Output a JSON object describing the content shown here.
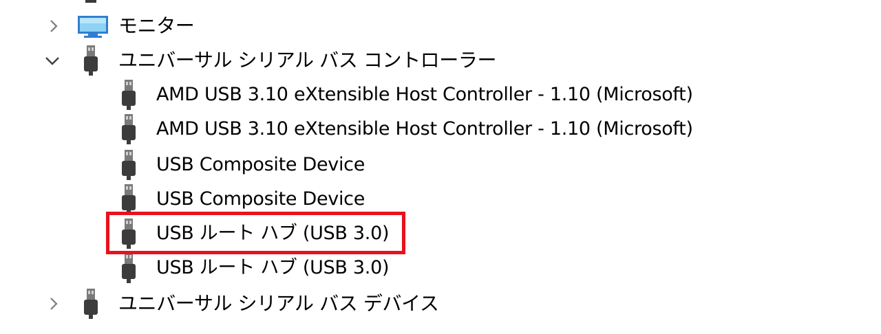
{
  "tree": {
    "highlight_color": "#e8121c",
    "nodes": [
      {
        "label": "モニター",
        "expander": "chevron-right",
        "icon": "monitor-icon"
      },
      {
        "label": "ユニバーサル シリアル バス コントローラー",
        "expander": "chevron-down",
        "icon": "usb-icon",
        "children": [
          {
            "label": "AMD USB 3.10 eXtensible Host Controller - 1.10 (Microsoft)",
            "icon": "usb-icon"
          },
          {
            "label": "AMD USB 3.10 eXtensible Host Controller - 1.10 (Microsoft)",
            "icon": "usb-icon"
          },
          {
            "label": "USB Composite Device",
            "icon": "usb-icon"
          },
          {
            "label": "USB Composite Device",
            "icon": "usb-icon"
          },
          {
            "label": "USB ルート ハブ (USB 3.0)",
            "icon": "usb-icon",
            "highlighted": true
          },
          {
            "label": "USB ルート ハブ (USB 3.0)",
            "icon": "usb-icon"
          }
        ]
      },
      {
        "label": "ユニバーサル シリアル バス デバイス",
        "expander": "chevron-right",
        "icon": "usb-icon"
      }
    ]
  }
}
